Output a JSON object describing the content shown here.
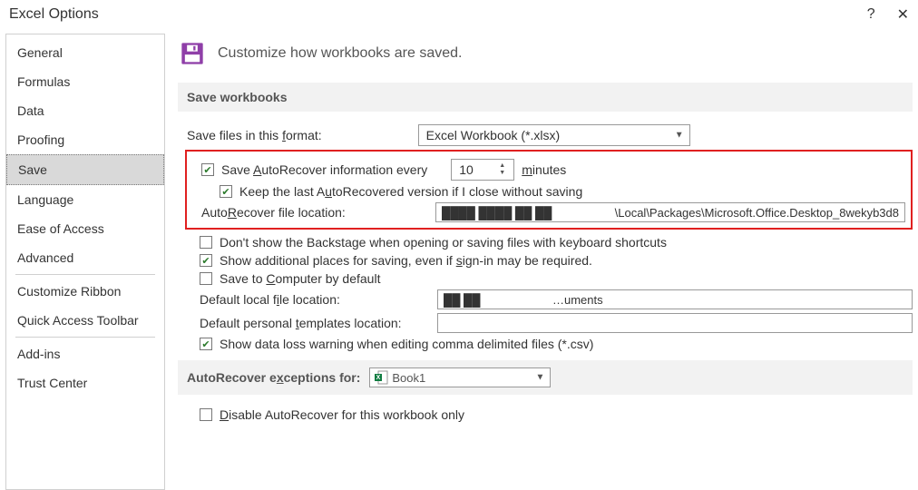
{
  "window": {
    "title": "Excel Options",
    "help_glyph": "?",
    "close_glyph": "✕"
  },
  "sidebar": {
    "items": [
      {
        "label": "General"
      },
      {
        "label": "Formulas"
      },
      {
        "label": "Data"
      },
      {
        "label": "Proofing"
      },
      {
        "label": "Save",
        "selected": true
      },
      {
        "label": "Language"
      },
      {
        "label": "Ease of Access"
      },
      {
        "label": "Advanced"
      }
    ],
    "items2": [
      {
        "label": "Customize Ribbon"
      },
      {
        "label": "Quick Access Toolbar"
      }
    ],
    "items3": [
      {
        "label": "Add-ins"
      },
      {
        "label": "Trust Center"
      }
    ]
  },
  "heading": "Customize how workbooks are saved.",
  "section1": {
    "title": "Save workbooks",
    "format_label_pre": "Save files in this ",
    "format_label_hot": "f",
    "format_label_post": "ormat:",
    "format_value": "Excel Workbook (*.xlsx)",
    "autorec_label_pre": "Save ",
    "autorec_label_hot": "A",
    "autorec_label_post": "utoRecover information every",
    "autorec_minutes_value": "10",
    "autorec_minutes_suffix_hot": "m",
    "autorec_minutes_suffix_post": "inutes",
    "keeplast_pre": "Keep the last A",
    "keeplast_hot": "u",
    "keeplast_post": "toRecovered version if I close without saving",
    "autorec_loc_label_pre": "Auto",
    "autorec_loc_label_hot": "R",
    "autorec_loc_label_post": "ecover file location:",
    "autorec_loc_value": "\\Local\\Packages\\Microsoft.Office.Desktop_8wekyb3d8",
    "backstage_label": "Don't show the Backstage when opening or saving files with keyboard shortcuts",
    "addplaces_pre": "Show additional places for saving, even if ",
    "addplaces_hot": "s",
    "addplaces_post": "ign-in may be required.",
    "savetocomp_pre": "Save to ",
    "savetocomp_hot": "C",
    "savetocomp_post": "omputer by default",
    "defloc_label_pre": "Default local f",
    "defloc_label_hot": "i",
    "defloc_label_post": "le location:",
    "defloc_value": "…uments",
    "tpl_label_pre": "Default personal ",
    "tpl_label_hot": "t",
    "tpl_label_post": "emplates location:",
    "tpl_value": "",
    "csvwarn_label": "Show data loss warning when editing comma delimited files (*.csv)"
  },
  "section2": {
    "title_pre": "AutoRecover e",
    "title_hot": "x",
    "title_post": "ceptions for:",
    "combo_value": "Book1",
    "disable_pre": "",
    "disable_hot": "D",
    "disable_post": "isable AutoRecover for this workbook only"
  }
}
